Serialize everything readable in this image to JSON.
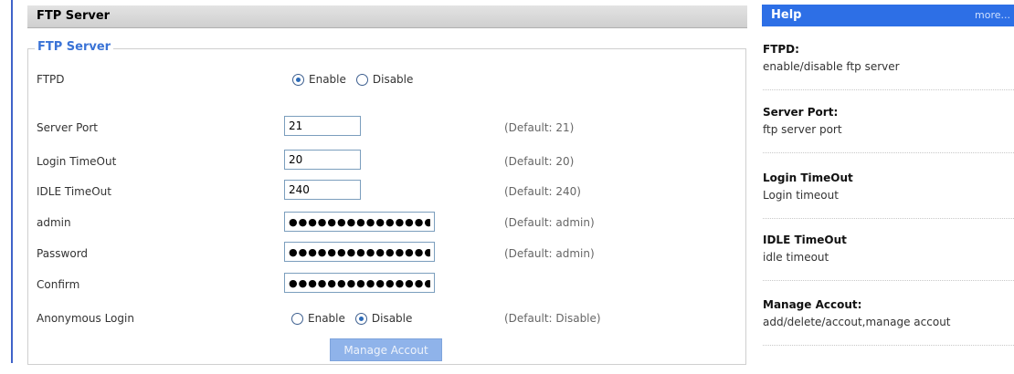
{
  "main": {
    "title": "FTP Server",
    "legend": "FTP Server"
  },
  "ftpd": {
    "label": "FTPD",
    "enable_label": "Enable",
    "disable_label": "Disable",
    "selected": "Enable"
  },
  "server_port": {
    "label": "Server Port",
    "value": "21",
    "default": "(Default: 21)"
  },
  "login_timeout": {
    "label": "Login TimeOut",
    "value": "20",
    "default": "(Default: 20)"
  },
  "idle_timeout": {
    "label": "IDLE TimeOut",
    "value": "240",
    "default": "(Default: 240)"
  },
  "admin": {
    "label": "admin",
    "value": "●●●●●●●●●●●●●●●●",
    "default": "(Default: admin)"
  },
  "password": {
    "label": "Password",
    "value": "●●●●●●●●●●●●●●●●",
    "default": "(Default: admin)"
  },
  "confirm": {
    "label": "Confirm",
    "value": "●●●●●●●●●●●●●●●●"
  },
  "anonymous": {
    "label": "Anonymous Login",
    "enable_label": "Enable",
    "disable_label": "Disable",
    "selected": "Disable",
    "default": "(Default: Disable)"
  },
  "manage_button": "Manage Accout",
  "help": {
    "title": "Help",
    "more": "more...",
    "items": [
      {
        "heading": "FTPD:",
        "desc": "enable/disable ftp server"
      },
      {
        "heading": "Server Port:",
        "desc": "ftp server port"
      },
      {
        "heading": "Login TimeOut",
        "desc": "Login timeout"
      },
      {
        "heading": "IDLE TimeOut",
        "desc": "idle timeout"
      },
      {
        "heading": "Manage Accout:",
        "desc": "add/delete/accout,manage accout"
      }
    ]
  },
  "colors": {
    "accent": "#2d6fe6",
    "legend": "#3a73d6",
    "button": "#8fb3ea"
  }
}
